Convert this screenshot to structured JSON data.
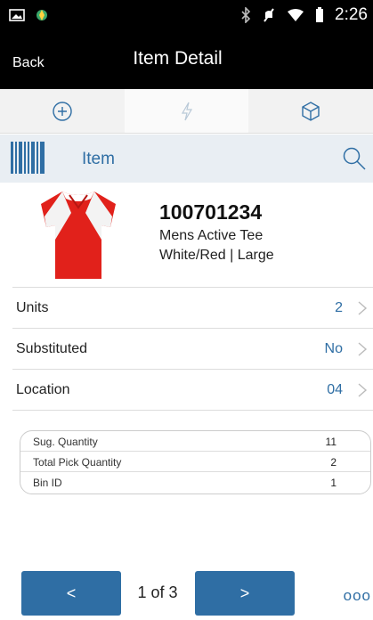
{
  "status_bar": {
    "time": "2:26"
  },
  "nav": {
    "back_label": "Back",
    "title": "Item Detail"
  },
  "tabs": [
    {
      "icon": "plus-circle-icon",
      "active": false
    },
    {
      "icon": "lightning-icon",
      "active": true
    },
    {
      "icon": "cube-icon",
      "active": false
    }
  ],
  "scan": {
    "label": "Item",
    "icon": "barcode-icon"
  },
  "item": {
    "id": "100701234",
    "description": "Mens Active Tee",
    "variant": "White/Red | Large"
  },
  "details": [
    {
      "label": "Units",
      "value": "2"
    },
    {
      "label": "Substituted",
      "value": "No"
    },
    {
      "label": "Location",
      "value": "04"
    }
  ],
  "summary": [
    {
      "label": "Sug. Quantity",
      "value": "11"
    },
    {
      "label": "Total Pick Quantity",
      "value": "2"
    },
    {
      "label": "Bin ID",
      "value": "1"
    }
  ],
  "footer": {
    "prev_label": "<",
    "next_label": ">",
    "page_indicator": "1 of 3",
    "more_label": "ooo"
  },
  "colors": {
    "accent": "#2f6ea4",
    "bar": "#000000",
    "scan_bg": "#e9eef3"
  }
}
